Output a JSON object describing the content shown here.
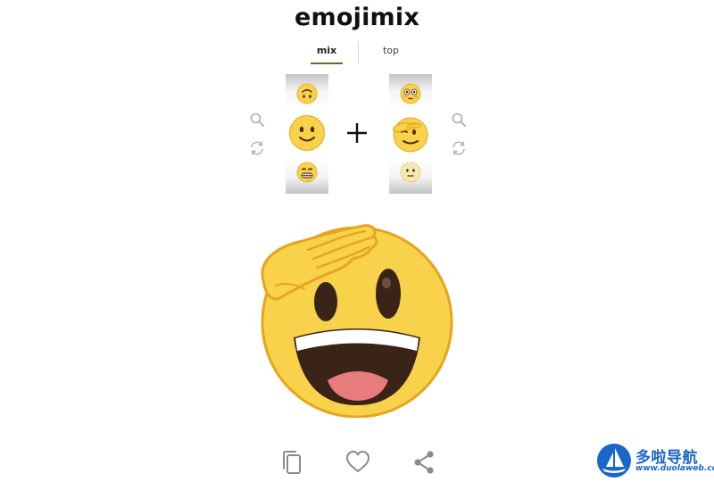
{
  "app": {
    "title": "emojimix"
  },
  "tabs": [
    {
      "label": "mix",
      "active": true
    },
    {
      "label": "top",
      "active": false
    }
  ],
  "left_reel": {
    "items": [
      "upside-down-face",
      "slightly-smiling-face",
      "grimacing-face"
    ],
    "selected": "slightly-smiling-face"
  },
  "right_reel": {
    "items": [
      "flushed-face",
      "saluting-face",
      "dotted-line-face"
    ],
    "selected": "saluting-face"
  },
  "controls": {
    "left": [
      "search-icon",
      "shuffle-icon"
    ],
    "right": [
      "search-icon",
      "shuffle-icon"
    ],
    "combine": "plus-icon"
  },
  "result": {
    "emoji": "saluting-grinning-face"
  },
  "actions": [
    "copy-icon",
    "heart-icon",
    "share-icon"
  ],
  "watermark": {
    "name": "多啦导航",
    "url": "www.duolaweb.com"
  },
  "colors": {
    "accent": "#6a6b2a",
    "emoji_yellow": "#f8d24a",
    "emoji_outline": "#e6a520",
    "icon_gray": "#b5b5b5",
    "action_gray": "#8a8a8a",
    "watermark_blue": "#1a66c9"
  }
}
